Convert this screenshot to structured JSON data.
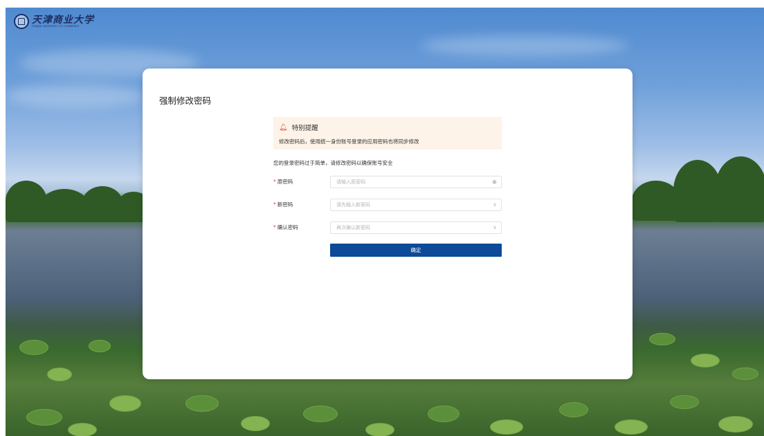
{
  "branding": {
    "name_cn": "天津商业大学",
    "name_en": "TIANJIN UNIVERSITY OF COMMERCE"
  },
  "page": {
    "title": "强制修改密码"
  },
  "notice": {
    "icon": "bell-icon",
    "heading": "特别提醒",
    "body": "修改密码后，使用统一身份账号登录的应用密码也将同步修改"
  },
  "hint": "您的登录密码过于简单，请修改密码以确保账号安全",
  "form": {
    "old_password": {
      "label": "原密码",
      "placeholder": "请输入原密码",
      "icon": "eye-icon"
    },
    "new_password": {
      "label": "新密码",
      "placeholder": "请先输入新密码",
      "icon": "chevron-down-icon"
    },
    "confirm_password": {
      "label": "确认密码",
      "placeholder": "再次确认新密码",
      "icon": "chevron-down-icon"
    },
    "required_mark": "*",
    "submit_label": "确定"
  },
  "colors": {
    "primary": "#0d4a97",
    "notice_bg": "#fdf3e8",
    "required": "#e0432f",
    "bell": "#e05a4a"
  }
}
